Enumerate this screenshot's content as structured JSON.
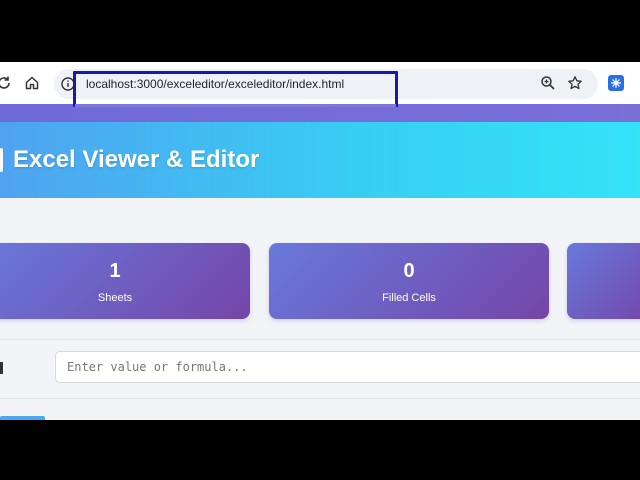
{
  "browser": {
    "url": "localhost:3000/exceleditor/exceleditor/index.html",
    "icons": [
      "reload-icon",
      "home-icon",
      "site-info-icon",
      "zoom-icon",
      "bookmark-star-icon",
      "extension-icon"
    ]
  },
  "app": {
    "title": "Excel Viewer & Editor"
  },
  "stats": [
    {
      "value": "1",
      "label": "Sheets"
    },
    {
      "value": "0",
      "label": "Filled Cells"
    },
    {
      "value": "",
      "label": ""
    }
  ],
  "formula_bar": {
    "value": "",
    "placeholder": "Enter value or formula..."
  },
  "colors": {
    "header_gradient_start": "#4fa3f0",
    "header_gradient_end": "#33e3f8",
    "card_gradient_start": "#6879dc",
    "card_gradient_end": "#7545a8",
    "highlight_box": "#1a18a8"
  }
}
